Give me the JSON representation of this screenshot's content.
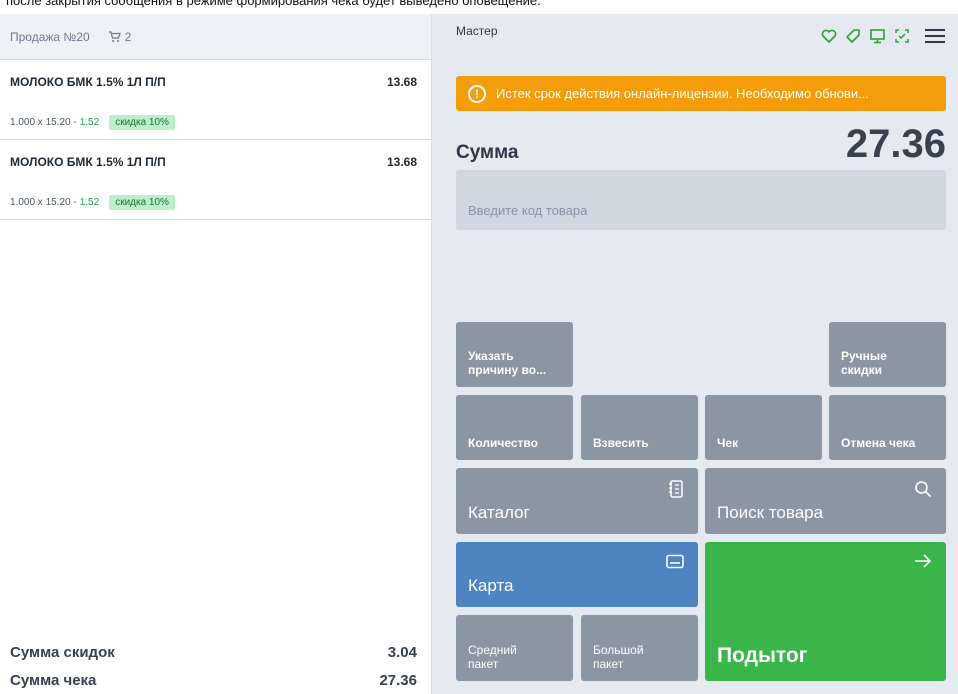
{
  "top_text": "после закрытия сообщения в режиме формирования чека будет выведено оповещение.",
  "sale": {
    "title": "Продажа №20",
    "cart_count": "2"
  },
  "items": [
    {
      "name": "МОЛОКО БМК 1.5% 1Л П/П",
      "price": "13.68",
      "calc": "1.000 x 15.20 -",
      "discount": "1.52",
      "badge": "скидка 10%"
    },
    {
      "name": "МОЛОКО БМК 1.5% 1Л П/П",
      "price": "13.68",
      "calc": "1.000 x 15.20 -",
      "discount": "1.52",
      "badge": "скидка 10%"
    }
  ],
  "totals": {
    "discount_label": "Сумма скидок",
    "discount_value": "3.04",
    "check_label": "Сумма чека",
    "check_value": "27.36"
  },
  "header": {
    "user": "Мастер"
  },
  "alert": {
    "icon": "!",
    "text": "Истек срок действия онлайн-лицензии. Необходимо обнови..."
  },
  "sum": {
    "label": "Сумма",
    "value": "27.36"
  },
  "input": {
    "placeholder": "Введите код товара"
  },
  "buttons": {
    "reason": "Указать причину во...",
    "manual_discounts": "Ручные скидки",
    "quantity": "Количество",
    "weigh": "Взвесить",
    "check": "Чек",
    "cancel_check": "Отмена чека",
    "catalog": "Каталог",
    "search": "Поиск товара",
    "card": "Карта",
    "medium_bag": "Средний пакет",
    "large_bag": "Большой пакет",
    "subtotal": "Подытог"
  },
  "colors": {
    "alert": "#f59c0b",
    "green": "#39b54a",
    "blue": "#4e84c2",
    "gray_button": "#8a96a3",
    "status_icons": "#2e9e3e"
  },
  "icons": [
    "heart-icon",
    "tag-icon",
    "monitor-icon",
    "check-frame-icon",
    "menu-icon",
    "cart-icon",
    "catalog-icon",
    "search-icon",
    "card-icon",
    "arrow-right-icon",
    "alert-icon"
  ]
}
